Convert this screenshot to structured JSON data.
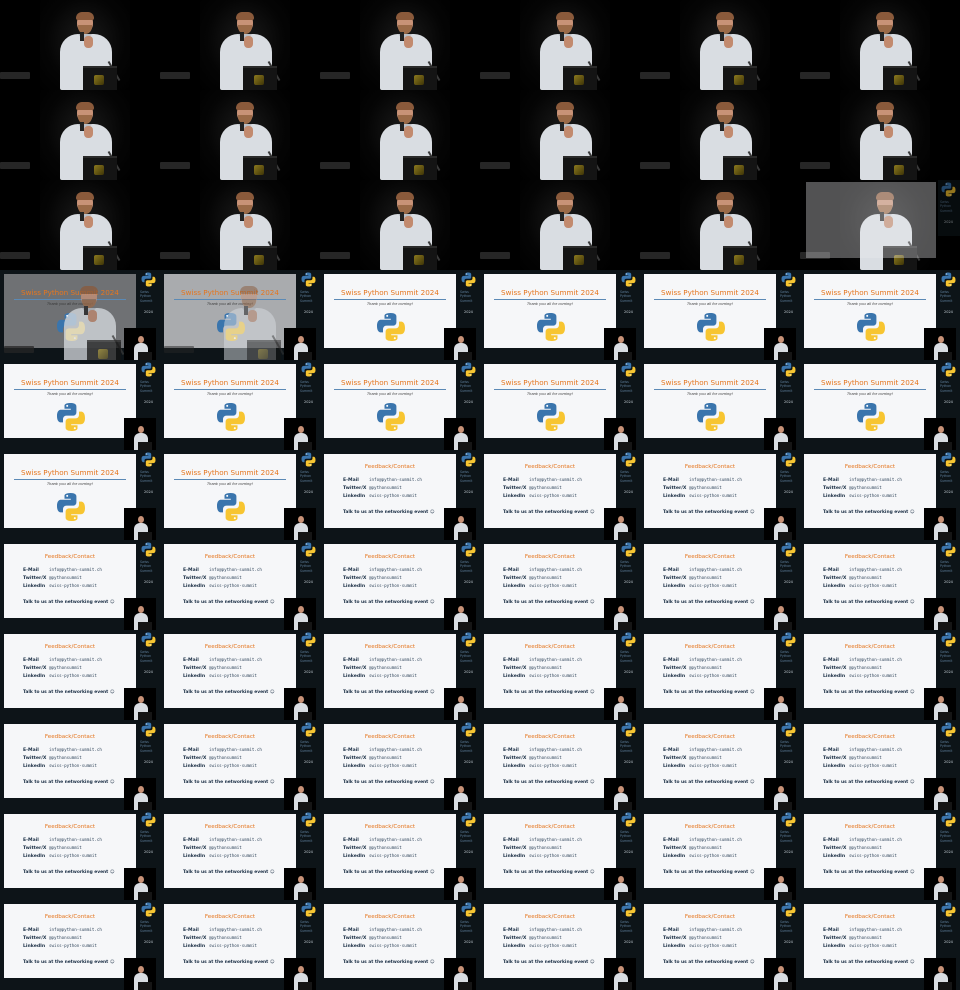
{
  "grid": {
    "columns": 6,
    "rows": 11
  },
  "thanks_slide": {
    "title": "Swiss Python Summit 2024",
    "subtitle": "Thank you all for coming!"
  },
  "contact_slide": {
    "title": "Feedback/Contact",
    "rows": [
      {
        "label": "E-Mail",
        "value": "info@python-summit.ch"
      },
      {
        "label": "Twitter/X",
        "value": "@pythonsummit"
      },
      {
        "label": "LinkedIn",
        "value": "swiss-python-summit"
      }
    ],
    "networking": "Talk to us at the networking event"
  },
  "sidebar": {
    "text": "Swiss Python Summit",
    "year": "2024"
  },
  "colors": {
    "accent": "#e5761f",
    "python_blue": "#3a75ad",
    "python_yellow": "#f7c531",
    "slide_bg": "#f6f7f9",
    "frame_bg": "#0d1418"
  },
  "frames": [
    "speaker",
    "speaker",
    "speaker",
    "speaker",
    "speaker",
    "speaker",
    "speaker",
    "speaker",
    "speaker",
    "speaker",
    "speaker",
    "speaker",
    "speaker",
    "speaker",
    "speaker",
    "speaker",
    "speaker",
    "trans_small",
    "trans_fade",
    "trans_fade_light",
    "thanks",
    "thanks",
    "thanks",
    "thanks",
    "thanks",
    "thanks",
    "thanks",
    "thanks",
    "thanks",
    "thanks",
    "thanks",
    "thanks",
    "contact",
    "contact",
    "contact",
    "contact",
    "contact",
    "contact",
    "contact",
    "contact",
    "contact",
    "contact",
    "contact",
    "contact",
    "contact",
    "contact",
    "contact",
    "contact",
    "contact",
    "contact",
    "contact",
    "contact",
    "contact",
    "contact",
    "contact",
    "contact",
    "contact",
    "contact",
    "contact",
    "contact",
    "contact",
    "contact",
    "contact",
    "contact",
    "contact",
    "contact"
  ]
}
